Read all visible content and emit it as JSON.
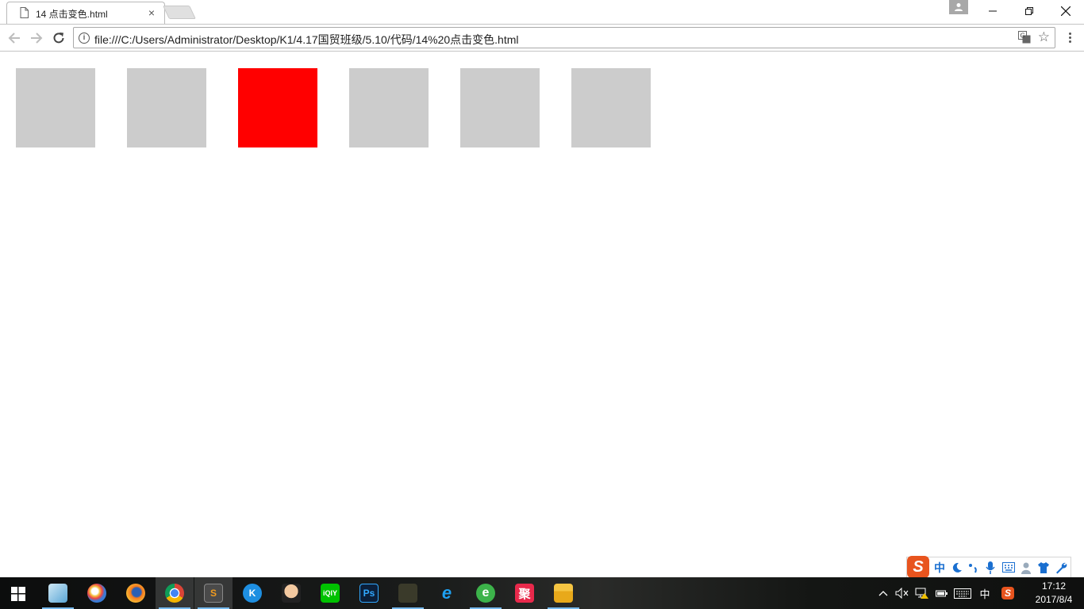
{
  "browser": {
    "tab": {
      "title": "14 点击变色.html",
      "close_glyph": "×"
    },
    "url": "file:///C:/Users/Administrator/Desktop/K1/4.17国贸班级/5.10/代码/14%20点击变色.html"
  },
  "page": {
    "boxes": [
      {
        "color": "#cccccc"
      },
      {
        "color": "#cccccc"
      },
      {
        "color": "#ff0000"
      },
      {
        "color": "#cccccc"
      },
      {
        "color": "#cccccc"
      },
      {
        "color": "#cccccc"
      }
    ]
  },
  "ime": {
    "logo": "S",
    "mode": "中",
    "items": [
      "moon-icon",
      "punctuation-icon",
      "mic-icon",
      "keyboard-icon",
      "user-icon",
      "skin-icon",
      "wrench-icon"
    ]
  },
  "taskbar": {
    "apps": [
      {
        "icon": "notepad-icon",
        "label": ""
      },
      {
        "icon": "paint-icon",
        "label": ""
      },
      {
        "icon": "firefox-icon",
        "label": ""
      },
      {
        "icon": "chrome-icon",
        "label": ""
      },
      {
        "icon": "sublime-icon",
        "label": "S"
      },
      {
        "icon": "kugou-icon",
        "label": "K"
      },
      {
        "icon": "avatar-app-icon",
        "label": ""
      },
      {
        "icon": "iqiyi-icon",
        "label": "iQIY"
      },
      {
        "icon": "photoshop-icon",
        "label": "Ps"
      },
      {
        "icon": "camera-app-icon",
        "label": ""
      },
      {
        "icon": "ie-icon",
        "label": "e"
      },
      {
        "icon": "green-browser-icon",
        "label": "e"
      },
      {
        "icon": "ju-app-icon",
        "label": "聚"
      },
      {
        "icon": "file-explorer-icon",
        "label": ""
      }
    ],
    "tray": {
      "ime_mode": "中",
      "ime_logo": "S"
    },
    "clock": {
      "time": "17:12",
      "date": "2017/8/4"
    }
  },
  "colors": {
    "accent_underline": "#76b9ed",
    "box_default": "#cccccc",
    "box_active": "#ff0000"
  }
}
